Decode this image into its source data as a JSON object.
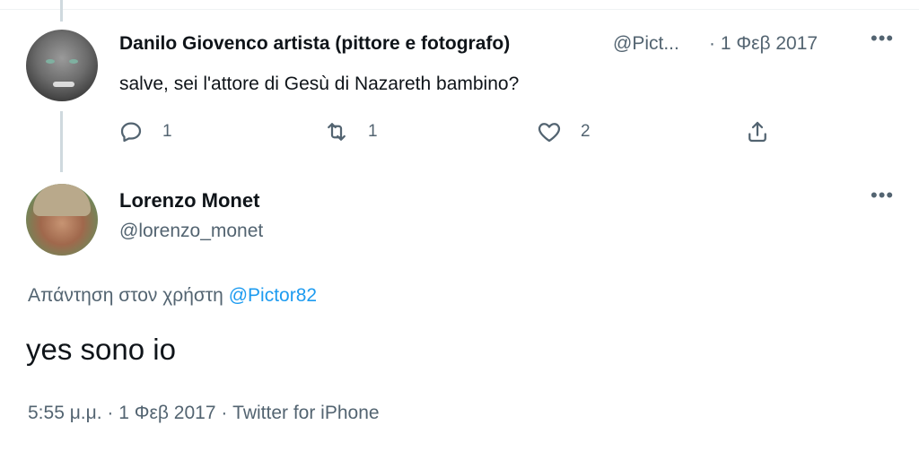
{
  "parent_tweet": {
    "author_name": "Danilo Giovenco artista (pittore e fotografo)",
    "author_handle": "@Pict...",
    "date": "· 1 Φεβ 2017",
    "text": "salve, sei l'attore di Gesù di Nazareth bambino?",
    "more_icon": "more-icon",
    "actions": {
      "reply_count": "1",
      "retweet_count": "1",
      "like_count": "2"
    }
  },
  "main_tweet": {
    "author_name": "Lorenzo Monet",
    "author_handle": "@lorenzo_monet",
    "replying_prefix": "Απάντηση στον χρήστη",
    "replying_to": "@Pictor82",
    "text": "yes sono io",
    "meta": "5:55 μ.μ. · 1 Φεβ 2017 · Twitter for iPhone"
  },
  "colors": {
    "accent": "#1d9bf0",
    "secondary_text": "#536471",
    "primary_text": "#0f1419",
    "thread_line": "#cfd9de"
  }
}
